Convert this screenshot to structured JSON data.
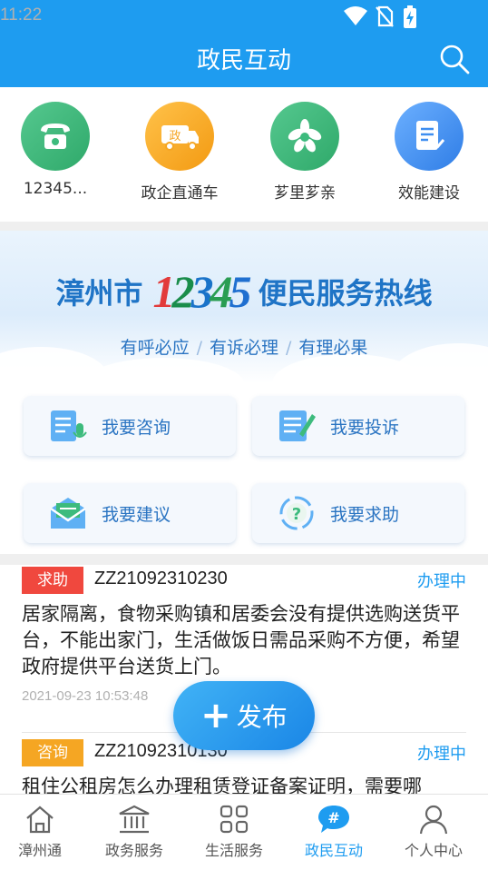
{
  "status_bar": {
    "time": "11:22",
    "icons": [
      "wifi-icon",
      "no-sim-icon",
      "battery-charging-icon"
    ]
  },
  "header": {
    "title": "政民互动",
    "search_icon": "search-icon"
  },
  "colors": {
    "primary": "#1e9cf0",
    "help_tag": "#f0483e",
    "consult_tag": "#f5a623"
  },
  "quick_actions": [
    {
      "label": "12345...",
      "icon": "phone-icon",
      "color": "#3dbb7d"
    },
    {
      "label": "政企直通车",
      "icon": "truck-icon",
      "color": "#f5a623"
    },
    {
      "label": "芗里芗亲",
      "icon": "flower-icon",
      "color": "#3dbb7d"
    },
    {
      "label": "效能建设",
      "icon": "report-icon",
      "color": "#3e8ef0"
    }
  ],
  "banner": {
    "city": "漳州市",
    "number": [
      "1",
      "2",
      "3",
      "4",
      "5"
    ],
    "suffix": "便民服务热线",
    "slogans": [
      "有呼必应",
      "有诉必理",
      "有理必果"
    ]
  },
  "actions": [
    {
      "label": "我要咨询",
      "icon": "consult-icon"
    },
    {
      "label": "我要投诉",
      "icon": "complaint-icon"
    },
    {
      "label": "我要建议",
      "icon": "suggestion-icon"
    },
    {
      "label": "我要求助",
      "icon": "help-icon"
    }
  ],
  "feed": [
    {
      "tag": "求助",
      "code": "ZZ21092310230",
      "status": "办理中",
      "content": "居家隔离，食物采购镇和居委会没有提供选购送货平台，不能出家门，生活做饭日需品采购不方便，希望政府提供平台送货上门。",
      "time": "2021-09-23 10:53:48"
    },
    {
      "tag": "咨询",
      "code": "ZZ21092310130",
      "status": "办理中",
      "content": "租住公租房怎么办理租赁登证备案证明，需要哪"
    }
  ],
  "fab": {
    "label": "发布"
  },
  "bottom_nav": [
    {
      "label": "漳州通",
      "icon": "home-icon",
      "active": false
    },
    {
      "label": "政务服务",
      "icon": "government-icon",
      "active": false
    },
    {
      "label": "生活服务",
      "icon": "grid-icon",
      "active": false
    },
    {
      "label": "政民互动",
      "icon": "chat-hash-icon",
      "active": true
    },
    {
      "label": "个人中心",
      "icon": "person-icon",
      "active": false
    }
  ]
}
